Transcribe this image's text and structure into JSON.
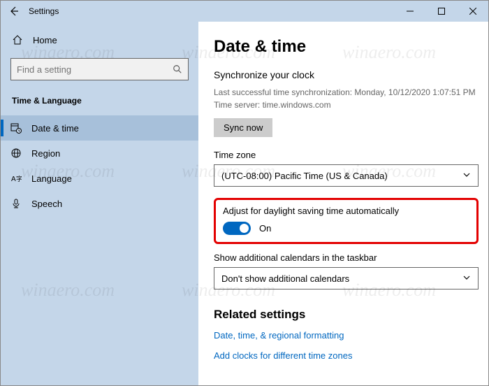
{
  "titlebar": {
    "title": "Settings"
  },
  "sidebar": {
    "home": "Home",
    "search_placeholder": "Find a setting",
    "section": "Time & Language",
    "items": [
      {
        "label": "Date & time"
      },
      {
        "label": "Region"
      },
      {
        "label": "Language"
      },
      {
        "label": "Speech"
      }
    ]
  },
  "main": {
    "heading": "Date & time",
    "sync_section_title": "Synchronize your clock",
    "last_sync": "Last successful time synchronization: Monday, 10/12/2020 1:07:51 PM",
    "time_server": "Time server: time.windows.com",
    "sync_button": "Sync now",
    "timezone_label": "Time zone",
    "timezone_value": "(UTC-08:00) Pacific Time (US & Canada)",
    "dst_label": "Adjust for daylight saving time automatically",
    "dst_state": "On",
    "additional_cal_label": "Show additional calendars in the taskbar",
    "additional_cal_value": "Don't show additional calendars",
    "related_heading": "Related settings",
    "link1": "Date, time, & regional formatting",
    "link2": "Add clocks for different time zones"
  },
  "watermark": "winaero.com"
}
